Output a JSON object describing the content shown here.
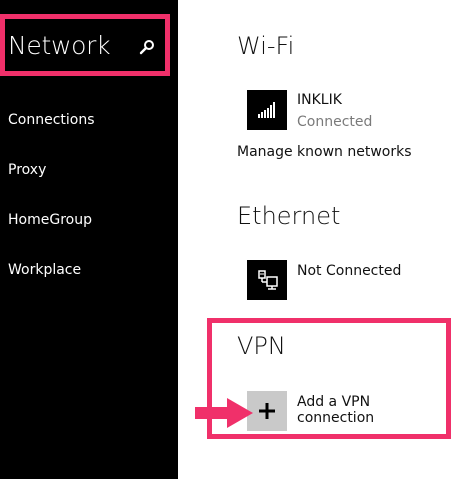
{
  "sidebar": {
    "title": "Network",
    "items": [
      {
        "label": "Connections"
      },
      {
        "label": "Proxy"
      },
      {
        "label": "HomeGroup"
      },
      {
        "label": "Workplace"
      }
    ]
  },
  "wifi": {
    "title": "Wi-Fi",
    "network_name": "INKLIK",
    "network_status": "Connected",
    "manage_label": "Manage known networks"
  },
  "ethernet": {
    "title": "Ethernet",
    "status": "Not Connected"
  },
  "vpn": {
    "title": "VPN",
    "add_label": "Add a VPN connection"
  },
  "icons": {
    "search": "search-icon",
    "wifi": "wifi-signal-icon",
    "ethernet": "ethernet-icon",
    "add": "plus-icon"
  },
  "colors": {
    "highlight": "#f0306a",
    "sidebar_bg": "#000000",
    "add_tile_bg": "#c9c9c9"
  }
}
